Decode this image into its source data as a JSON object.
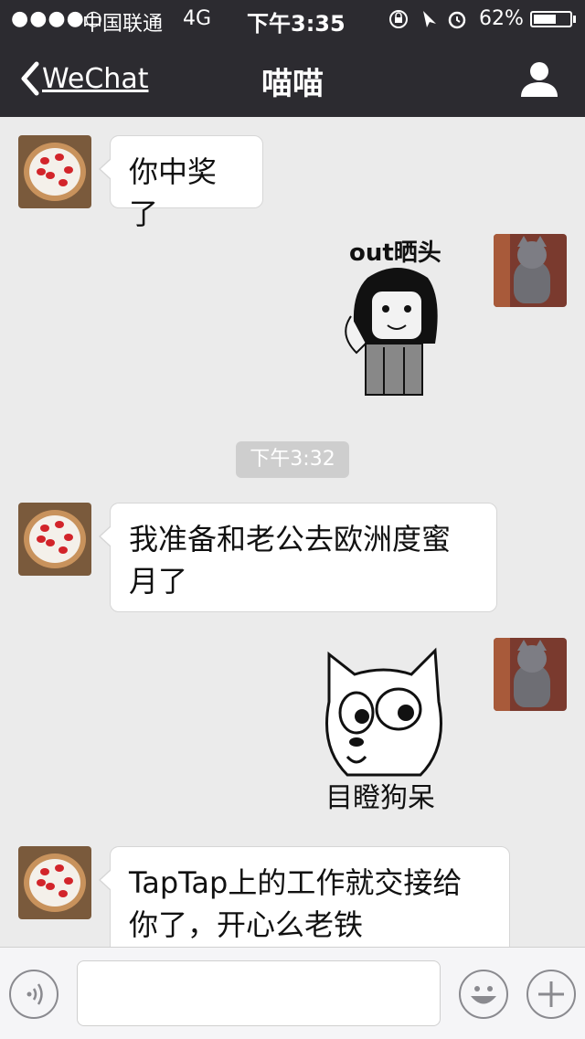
{
  "status_bar": {
    "signal": "●●●●○",
    "carrier": "中国联通",
    "network": "4G",
    "time": "下午3:35",
    "battery_percent": "62%",
    "battery_level": 0.62
  },
  "nav": {
    "back_label": "WeChat",
    "title": "喵喵"
  },
  "messages": {
    "m1": {
      "text": "你中奖了"
    },
    "sticker1": {
      "caption": "out晒头"
    },
    "timestamp": "下午3:32",
    "m2": {
      "text": "我准备和老公去欧洲度蜜月了"
    },
    "sticker2": {
      "caption": "目瞪狗呆"
    },
    "m3": {
      "text": "TapTap上的工作就交接给你了，开心么老铁"
    }
  },
  "input_bar": {
    "placeholder": ""
  },
  "icons": {
    "back": "chevron-left-icon",
    "profile": "person-icon",
    "voice": "voice-icon",
    "emoji": "emoji-icon",
    "more": "plus-icon"
  }
}
